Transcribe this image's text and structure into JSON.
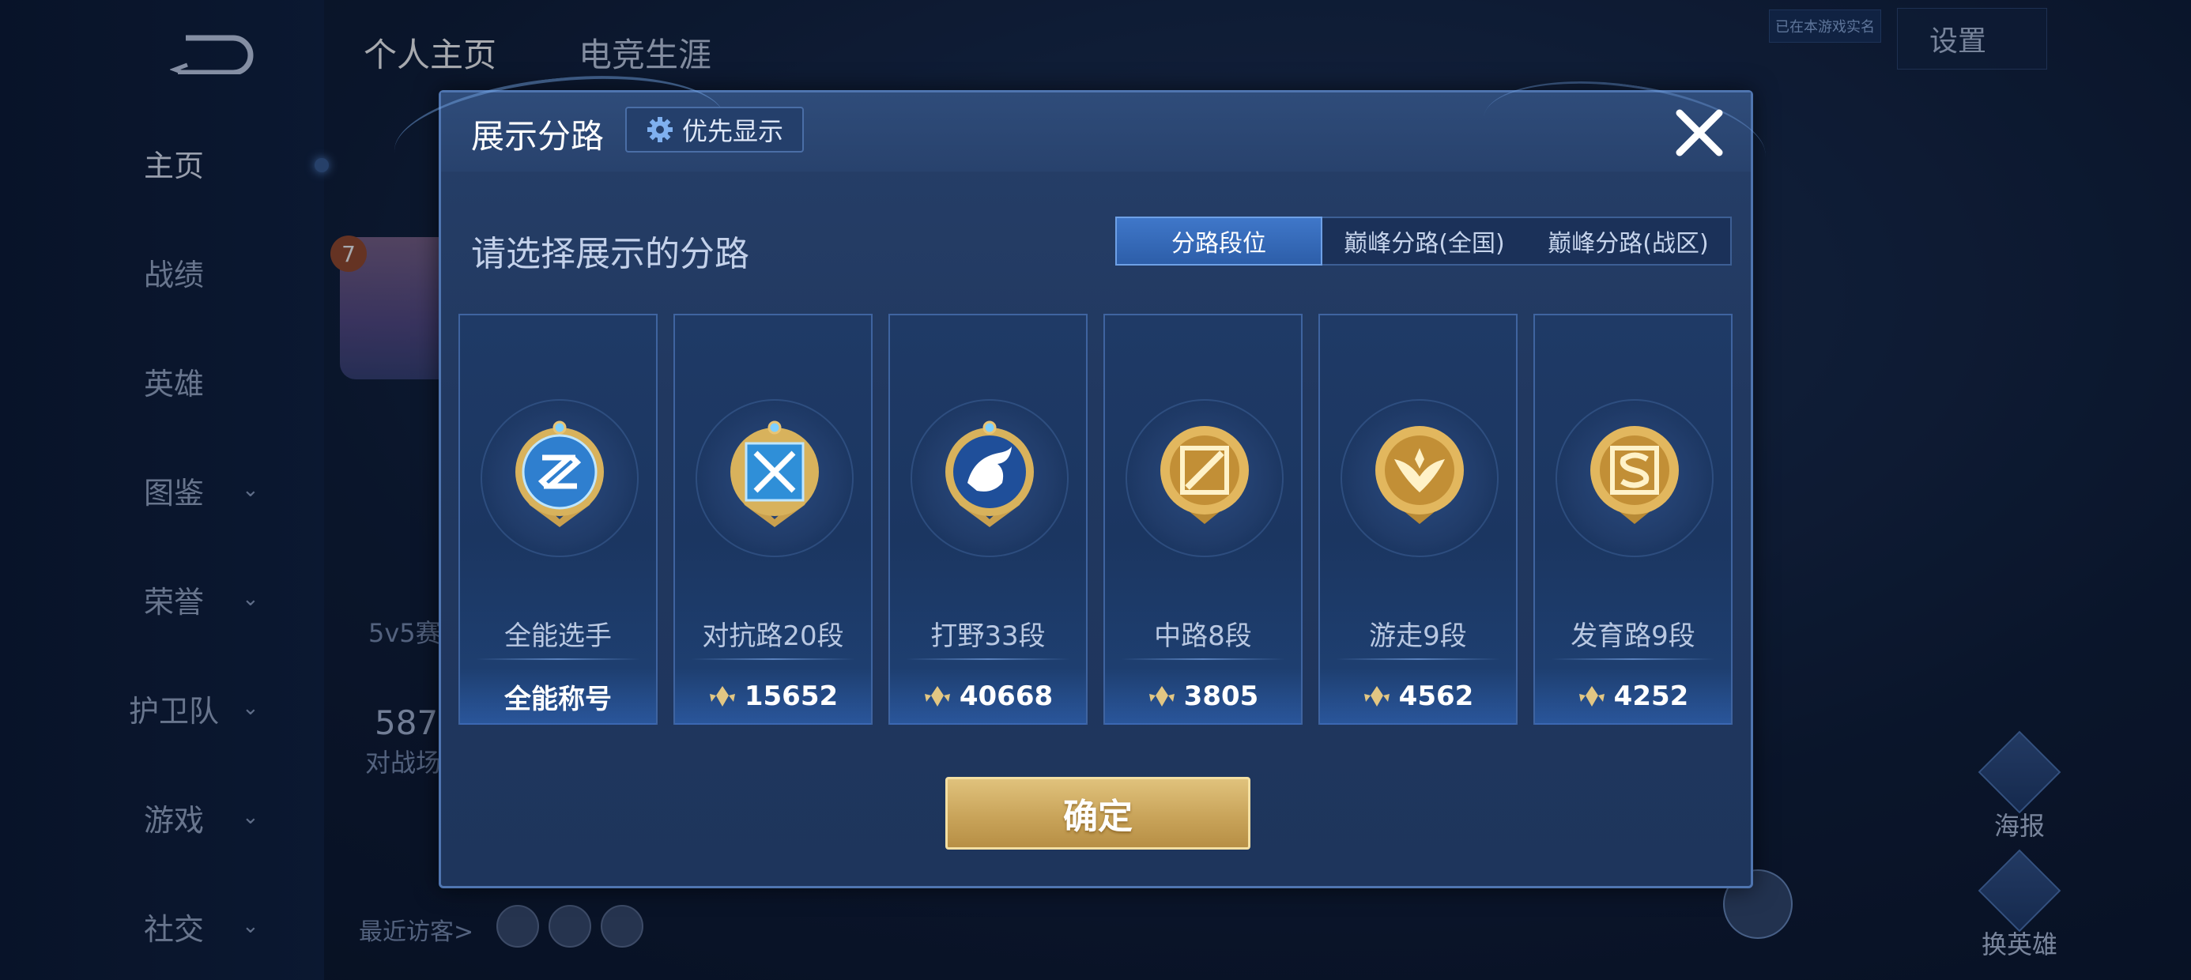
{
  "background": {
    "back_label": "",
    "top_tabs": [
      "个人主页",
      "电竞生涯"
    ],
    "settings_label": "设置",
    "top_chip": "已在本游戏实名",
    "sidebar": [
      {
        "label": "主页",
        "active": true,
        "chevron": false
      },
      {
        "label": "战绩",
        "active": false,
        "chevron": false
      },
      {
        "label": "英雄",
        "active": false,
        "chevron": false
      },
      {
        "label": "图鉴",
        "active": false,
        "chevron": true
      },
      {
        "label": "荣誉",
        "active": false,
        "chevron": true
      },
      {
        "label": "护卫队",
        "active": false,
        "chevron": true
      },
      {
        "label": "游戏",
        "active": false,
        "chevron": true
      },
      {
        "label": "社交",
        "active": false,
        "chevron": true
      }
    ],
    "level_badge": "7",
    "mode_text": "5v5赛",
    "count_text": "587",
    "count_sub": "对战场",
    "recent_visitors": "最近访客>",
    "right_actions": [
      "海报",
      "换英雄"
    ]
  },
  "modal": {
    "title": "展示分路",
    "priority_button": "优先显示",
    "subheading": "请选择展示的分路",
    "segments": [
      {
        "label": "分路段位",
        "active": true
      },
      {
        "label": "巅峰分路(全国)",
        "active": false
      },
      {
        "label": "巅峰分路(战区)",
        "active": false
      }
    ],
    "cards": [
      {
        "role": "全能选手",
        "value": "全能称号",
        "show_points_icon": false,
        "badge": "allround-badge-icon",
        "badge_color": "#4ea0e6"
      },
      {
        "role": "对抗路20段",
        "value": "15652",
        "show_points_icon": true,
        "badge": "clash-lane-badge-icon",
        "badge_color": "#4ea0e6"
      },
      {
        "role": "打野33段",
        "value": "40668",
        "show_points_icon": true,
        "badge": "jungle-badge-icon",
        "badge_color": "#4ea0e6"
      },
      {
        "role": "中路8段",
        "value": "3805",
        "show_points_icon": true,
        "badge": "mid-lane-badge-icon",
        "badge_color": "#d7a84a"
      },
      {
        "role": "游走9段",
        "value": "4562",
        "show_points_icon": true,
        "badge": "roam-badge-icon",
        "badge_color": "#d7a84a"
      },
      {
        "role": "发育路9段",
        "value": "4252",
        "show_points_icon": true,
        "badge": "farm-lane-badge-icon",
        "badge_color": "#d7a84a"
      }
    ],
    "confirm_label": "确定"
  }
}
